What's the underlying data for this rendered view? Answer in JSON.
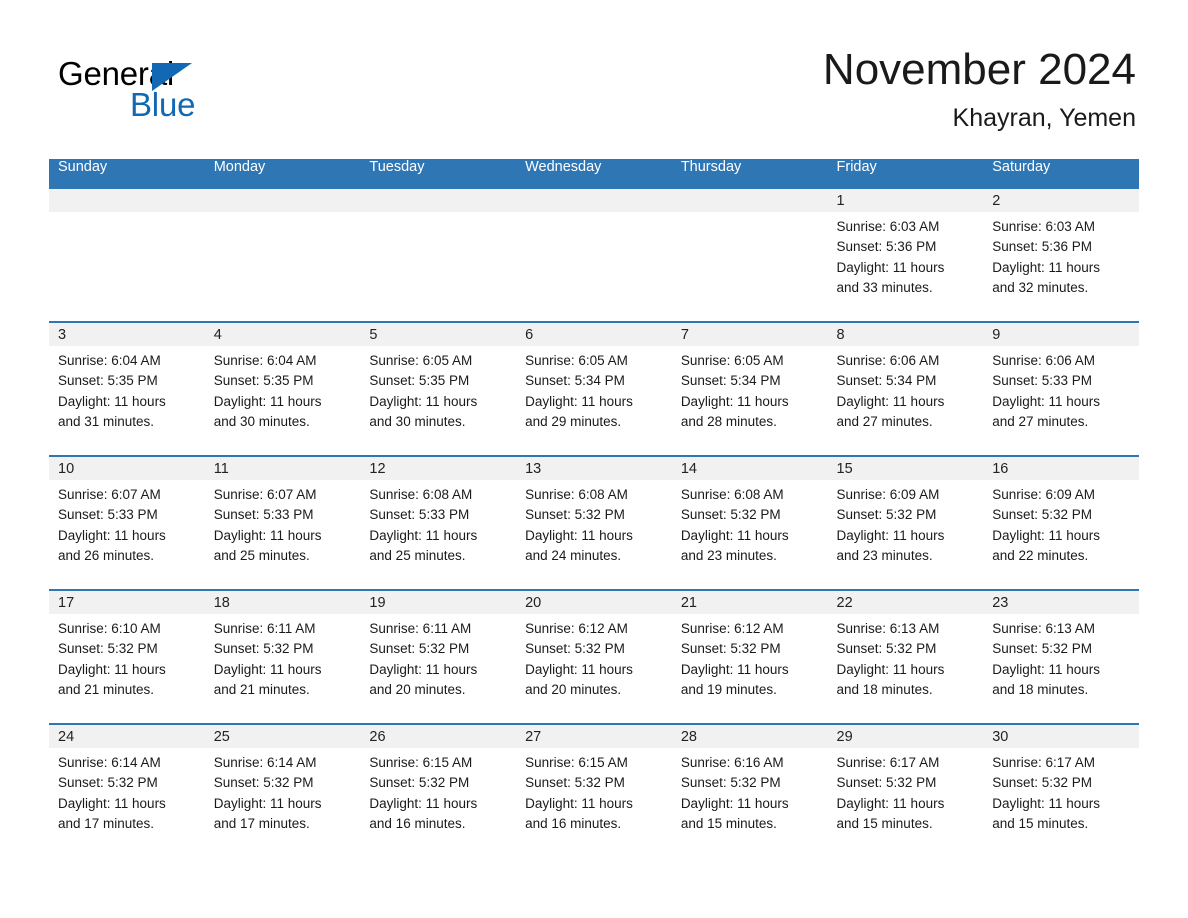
{
  "brand": {
    "name_part1": "General",
    "name_part2": "Blue"
  },
  "header": {
    "month_title": "November 2024",
    "location": "Khayran, Yemen"
  },
  "colors": {
    "header_blue": "#2f76b5",
    "brand_blue": "#1268b3",
    "daynum_band": "#f1f1f1",
    "text": "#1a1a1a"
  },
  "calendar": {
    "weekday_headers": [
      "Sunday",
      "Monday",
      "Tuesday",
      "Wednesday",
      "Thursday",
      "Friday",
      "Saturday"
    ],
    "weeks": [
      [
        {
          "day": "",
          "sunrise": "",
          "sunset": "",
          "daylight_line1": "",
          "daylight_line2": ""
        },
        {
          "day": "",
          "sunrise": "",
          "sunset": "",
          "daylight_line1": "",
          "daylight_line2": ""
        },
        {
          "day": "",
          "sunrise": "",
          "sunset": "",
          "daylight_line1": "",
          "daylight_line2": ""
        },
        {
          "day": "",
          "sunrise": "",
          "sunset": "",
          "daylight_line1": "",
          "daylight_line2": ""
        },
        {
          "day": "",
          "sunrise": "",
          "sunset": "",
          "daylight_line1": "",
          "daylight_line2": ""
        },
        {
          "day": "1",
          "sunrise": "Sunrise: 6:03 AM",
          "sunset": "Sunset: 5:36 PM",
          "daylight_line1": "Daylight: 11 hours",
          "daylight_line2": "and 33 minutes."
        },
        {
          "day": "2",
          "sunrise": "Sunrise: 6:03 AM",
          "sunset": "Sunset: 5:36 PM",
          "daylight_line1": "Daylight: 11 hours",
          "daylight_line2": "and 32 minutes."
        }
      ],
      [
        {
          "day": "3",
          "sunrise": "Sunrise: 6:04 AM",
          "sunset": "Sunset: 5:35 PM",
          "daylight_line1": "Daylight: 11 hours",
          "daylight_line2": "and 31 minutes."
        },
        {
          "day": "4",
          "sunrise": "Sunrise: 6:04 AM",
          "sunset": "Sunset: 5:35 PM",
          "daylight_line1": "Daylight: 11 hours",
          "daylight_line2": "and 30 minutes."
        },
        {
          "day": "5",
          "sunrise": "Sunrise: 6:05 AM",
          "sunset": "Sunset: 5:35 PM",
          "daylight_line1": "Daylight: 11 hours",
          "daylight_line2": "and 30 minutes."
        },
        {
          "day": "6",
          "sunrise": "Sunrise: 6:05 AM",
          "sunset": "Sunset: 5:34 PM",
          "daylight_line1": "Daylight: 11 hours",
          "daylight_line2": "and 29 minutes."
        },
        {
          "day": "7",
          "sunrise": "Sunrise: 6:05 AM",
          "sunset": "Sunset: 5:34 PM",
          "daylight_line1": "Daylight: 11 hours",
          "daylight_line2": "and 28 minutes."
        },
        {
          "day": "8",
          "sunrise": "Sunrise: 6:06 AM",
          "sunset": "Sunset: 5:34 PM",
          "daylight_line1": "Daylight: 11 hours",
          "daylight_line2": "and 27 minutes."
        },
        {
          "day": "9",
          "sunrise": "Sunrise: 6:06 AM",
          "sunset": "Sunset: 5:33 PM",
          "daylight_line1": "Daylight: 11 hours",
          "daylight_line2": "and 27 minutes."
        }
      ],
      [
        {
          "day": "10",
          "sunrise": "Sunrise: 6:07 AM",
          "sunset": "Sunset: 5:33 PM",
          "daylight_line1": "Daylight: 11 hours",
          "daylight_line2": "and 26 minutes."
        },
        {
          "day": "11",
          "sunrise": "Sunrise: 6:07 AM",
          "sunset": "Sunset: 5:33 PM",
          "daylight_line1": "Daylight: 11 hours",
          "daylight_line2": "and 25 minutes."
        },
        {
          "day": "12",
          "sunrise": "Sunrise: 6:08 AM",
          "sunset": "Sunset: 5:33 PM",
          "daylight_line1": "Daylight: 11 hours",
          "daylight_line2": "and 25 minutes."
        },
        {
          "day": "13",
          "sunrise": "Sunrise: 6:08 AM",
          "sunset": "Sunset: 5:32 PM",
          "daylight_line1": "Daylight: 11 hours",
          "daylight_line2": "and 24 minutes."
        },
        {
          "day": "14",
          "sunrise": "Sunrise: 6:08 AM",
          "sunset": "Sunset: 5:32 PM",
          "daylight_line1": "Daylight: 11 hours",
          "daylight_line2": "and 23 minutes."
        },
        {
          "day": "15",
          "sunrise": "Sunrise: 6:09 AM",
          "sunset": "Sunset: 5:32 PM",
          "daylight_line1": "Daylight: 11 hours",
          "daylight_line2": "and 23 minutes."
        },
        {
          "day": "16",
          "sunrise": "Sunrise: 6:09 AM",
          "sunset": "Sunset: 5:32 PM",
          "daylight_line1": "Daylight: 11 hours",
          "daylight_line2": "and 22 minutes."
        }
      ],
      [
        {
          "day": "17",
          "sunrise": "Sunrise: 6:10 AM",
          "sunset": "Sunset: 5:32 PM",
          "daylight_line1": "Daylight: 11 hours",
          "daylight_line2": "and 21 minutes."
        },
        {
          "day": "18",
          "sunrise": "Sunrise: 6:11 AM",
          "sunset": "Sunset: 5:32 PM",
          "daylight_line1": "Daylight: 11 hours",
          "daylight_line2": "and 21 minutes."
        },
        {
          "day": "19",
          "sunrise": "Sunrise: 6:11 AM",
          "sunset": "Sunset: 5:32 PM",
          "daylight_line1": "Daylight: 11 hours",
          "daylight_line2": "and 20 minutes."
        },
        {
          "day": "20",
          "sunrise": "Sunrise: 6:12 AM",
          "sunset": "Sunset: 5:32 PM",
          "daylight_line1": "Daylight: 11 hours",
          "daylight_line2": "and 20 minutes."
        },
        {
          "day": "21",
          "sunrise": "Sunrise: 6:12 AM",
          "sunset": "Sunset: 5:32 PM",
          "daylight_line1": "Daylight: 11 hours",
          "daylight_line2": "and 19 minutes."
        },
        {
          "day": "22",
          "sunrise": "Sunrise: 6:13 AM",
          "sunset": "Sunset: 5:32 PM",
          "daylight_line1": "Daylight: 11 hours",
          "daylight_line2": "and 18 minutes."
        },
        {
          "day": "23",
          "sunrise": "Sunrise: 6:13 AM",
          "sunset": "Sunset: 5:32 PM",
          "daylight_line1": "Daylight: 11 hours",
          "daylight_line2": "and 18 minutes."
        }
      ],
      [
        {
          "day": "24",
          "sunrise": "Sunrise: 6:14 AM",
          "sunset": "Sunset: 5:32 PM",
          "daylight_line1": "Daylight: 11 hours",
          "daylight_line2": "and 17 minutes."
        },
        {
          "day": "25",
          "sunrise": "Sunrise: 6:14 AM",
          "sunset": "Sunset: 5:32 PM",
          "daylight_line1": "Daylight: 11 hours",
          "daylight_line2": "and 17 minutes."
        },
        {
          "day": "26",
          "sunrise": "Sunrise: 6:15 AM",
          "sunset": "Sunset: 5:32 PM",
          "daylight_line1": "Daylight: 11 hours",
          "daylight_line2": "and 16 minutes."
        },
        {
          "day": "27",
          "sunrise": "Sunrise: 6:15 AM",
          "sunset": "Sunset: 5:32 PM",
          "daylight_line1": "Daylight: 11 hours",
          "daylight_line2": "and 16 minutes."
        },
        {
          "day": "28",
          "sunrise": "Sunrise: 6:16 AM",
          "sunset": "Sunset: 5:32 PM",
          "daylight_line1": "Daylight: 11 hours",
          "daylight_line2": "and 15 minutes."
        },
        {
          "day": "29",
          "sunrise": "Sunrise: 6:17 AM",
          "sunset": "Sunset: 5:32 PM",
          "daylight_line1": "Daylight: 11 hours",
          "daylight_line2": "and 15 minutes."
        },
        {
          "day": "30",
          "sunrise": "Sunrise: 6:17 AM",
          "sunset": "Sunset: 5:32 PM",
          "daylight_line1": "Daylight: 11 hours",
          "daylight_line2": "and 15 minutes."
        }
      ]
    ]
  }
}
